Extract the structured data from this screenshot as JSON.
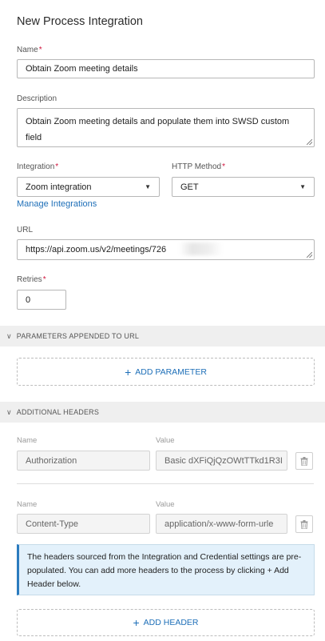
{
  "page": {
    "title": "New Process Integration"
  },
  "name": {
    "label": "Name",
    "value": "Obtain Zoom meeting details"
  },
  "description": {
    "label": "Description",
    "value": "Obtain Zoom meeting details and populate them into SWSD custom field"
  },
  "integration": {
    "label": "Integration",
    "value": "Zoom integration",
    "manage_link": "Manage Integrations"
  },
  "http_method": {
    "label": "HTTP Method",
    "value": "GET"
  },
  "url": {
    "label": "URL",
    "value": "https://api.zoom.us/v2/meetings/726"
  },
  "retries": {
    "label": "Retries",
    "value": "0"
  },
  "required_mark": "*",
  "params_section": {
    "title": "PARAMETERS APPENDED TO URL",
    "add_label": "ADD PARAMETER"
  },
  "headers_section": {
    "title": "ADDITIONAL HEADERS",
    "name_col": "Name",
    "value_col": "Value",
    "rows": [
      {
        "name": "Authorization",
        "value": "Basic dXFiQjQzOWtTTkd1R3I"
      },
      {
        "name": "Content-Type",
        "value": "application/x-www-form-urle"
      }
    ],
    "info": "The headers sourced from the Integration and Credential settings are pre-populated. You can add more headers to the process by clicking + Add Header below.",
    "add_label": "ADD HEADER"
  },
  "icons": {
    "dropdown": "caret-down-icon",
    "section": "chevron-down-icon",
    "delete": "trash-icon",
    "add": "plus-icon"
  }
}
